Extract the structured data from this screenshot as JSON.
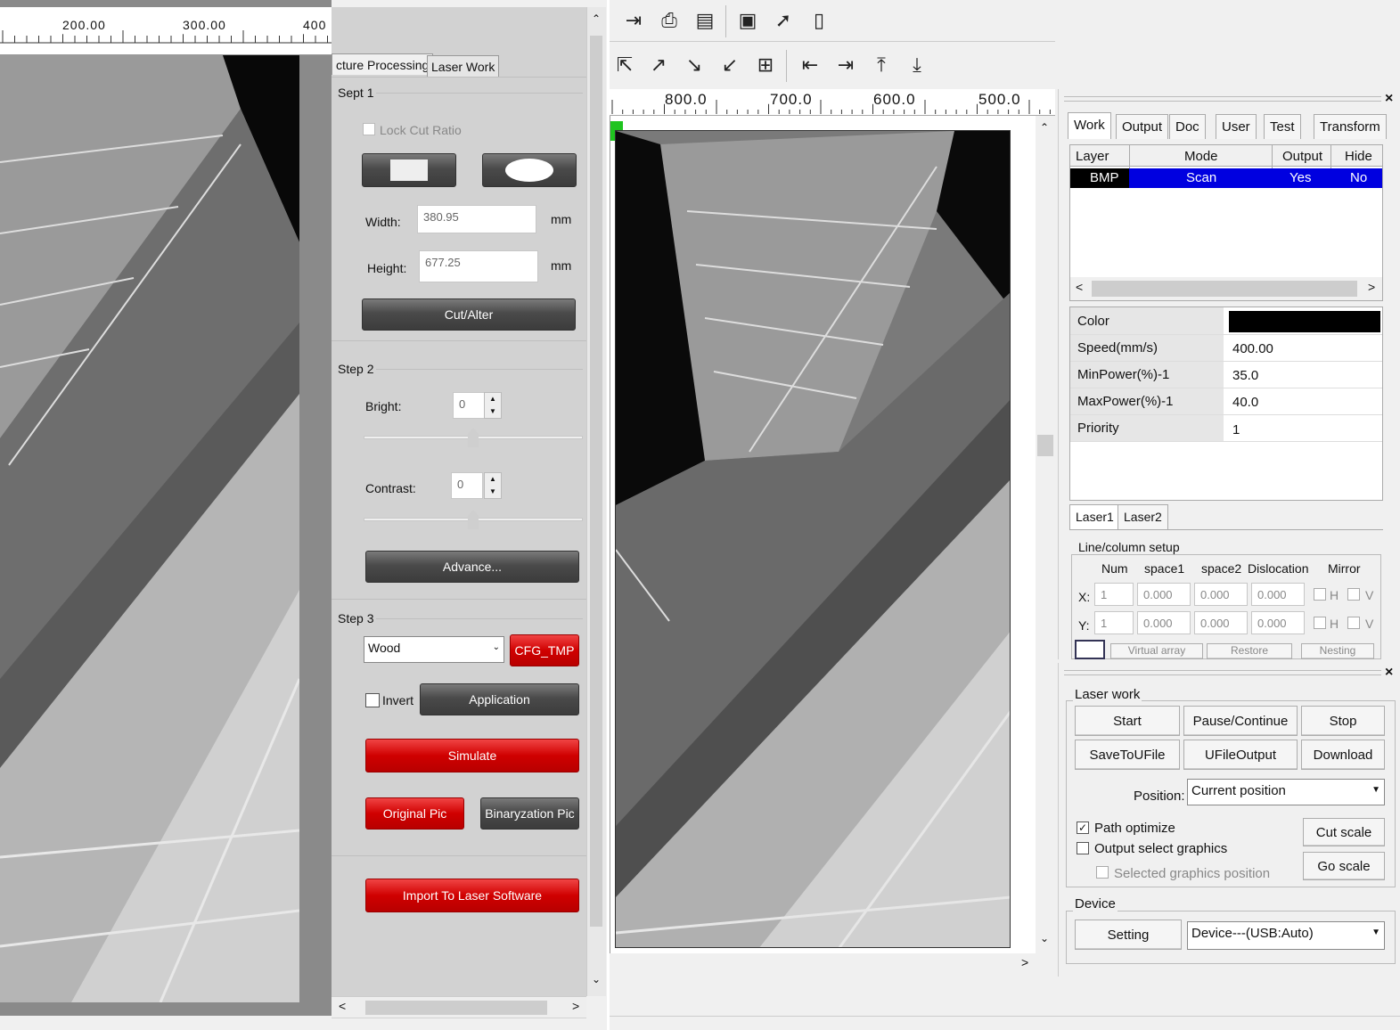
{
  "left_ruler": {
    "labels": [
      "200.00",
      "300.00",
      "400"
    ]
  },
  "processing": {
    "tabs": [
      "cture Processing",
      "Laser Work"
    ],
    "step1": {
      "label": "Sept 1",
      "lock_cut_ratio": "Lock Cut Ratio",
      "width_label": "Width:",
      "width_value": "380.95",
      "width_unit": "mm",
      "height_label": "Height:",
      "height_value": "677.25",
      "height_unit": "mm",
      "cut_button": "Cut/Alter"
    },
    "step2": {
      "label": "Step 2",
      "bright_label": "Bright:",
      "bright_value": "0",
      "contrast_label": "Contrast:",
      "contrast_value": "0",
      "advance_button": "Advance..."
    },
    "step3": {
      "label": "Step 3",
      "material": "Wood",
      "cfg_button": "CFG_TMP",
      "invert_label": "Invert",
      "application_button": "Application",
      "simulate_button": "Simulate",
      "original_button": "Original Pic",
      "binary_button": "Binaryzation Pic",
      "import_button": "Import To Laser Software"
    }
  },
  "mid_ruler": {
    "labels": [
      "800.0",
      "700.0",
      "600.0",
      "500.0"
    ]
  },
  "right": {
    "tabs": [
      "Work",
      "Output",
      "Doc",
      "User",
      "Test",
      "Transform"
    ],
    "layer_table": {
      "headers": [
        "Layer",
        "Mode",
        "Output",
        "Hide"
      ],
      "rows": [
        [
          "BMP",
          "Scan",
          "Yes",
          "No"
        ]
      ]
    },
    "props": [
      {
        "label": "Color",
        "value": ""
      },
      {
        "label": "Speed(mm/s)",
        "value": "400.00"
      },
      {
        "label": "MinPower(%)-1",
        "value": "35.0"
      },
      {
        "label": "MaxPower(%)-1",
        "value": "40.0"
      },
      {
        "label": "Priority",
        "value": "1"
      }
    ],
    "laser_tabs": [
      "Laser1",
      "Laser2"
    ],
    "line_setup": {
      "title": "Line/column setup",
      "headers": [
        "Num",
        "space1",
        "space2",
        "Dislocation",
        "Mirror"
      ],
      "x_label": "X:",
      "y_label": "Y:",
      "x_values": [
        "1",
        "0.000",
        "0.000",
        "0.000"
      ],
      "y_values": [
        "1",
        "0.000",
        "0.000",
        "0.000"
      ],
      "mirror_h": "H",
      "mirror_v": "V",
      "bottom_buttons": [
        "Virtual array",
        "Restore",
        "Nesting"
      ]
    },
    "laser_work": {
      "title": "Laser work",
      "buttons_row1": [
        "Start",
        "Pause/Continue",
        "Stop"
      ],
      "buttons_row2": [
        "SaveToUFile",
        "UFileOutput",
        "Download"
      ],
      "position_label": "Position:",
      "position_value": "Current position",
      "path_optimize": "Path optimize",
      "output_select": "Output select graphics",
      "selected_pos": "Selected graphics position",
      "cut_scale": "Cut scale",
      "go_scale": "Go scale"
    },
    "device": {
      "title": "Device",
      "setting_button": "Setting",
      "device_value": "Device---(USB:Auto)"
    }
  },
  "colors": {
    "layer_blue": "#0000e0",
    "red_button": "#d00000",
    "layer_color": "#000000"
  }
}
